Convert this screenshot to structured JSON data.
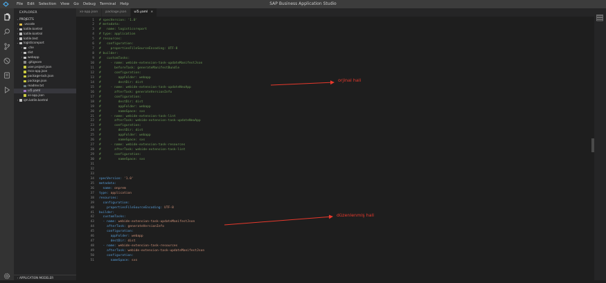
{
  "window": {
    "title": "SAP Business Application Studio",
    "menu": [
      "File",
      "Edit",
      "Selection",
      "View",
      "Go",
      "Debug",
      "Terminal",
      "Help"
    ]
  },
  "activity_bar": {
    "icons": [
      "files-icon",
      "search-icon",
      "source-control-icon",
      "debug-icon",
      "extensions-icon",
      "run-icon"
    ]
  },
  "sidebar": {
    "title": "EXPLORER",
    "section": "PROJECTS",
    "items": [
      {
        "label": ".vscode",
        "depth": 0,
        "type": "folder",
        "color": "#e6c34c"
      },
      {
        "label": "katile.kontrol",
        "depth": 0,
        "type": "folder",
        "color": "#c5c5c5"
      },
      {
        "label": "katile.kontrol",
        "depth": 0,
        "type": "folder",
        "color": "#c5c5c5"
      },
      {
        "label": "katile.test",
        "depth": 0,
        "type": "folder",
        "color": "#c5c5c5"
      },
      {
        "label": "logisticsreport",
        "depth": 0,
        "type": "folder-open",
        "color": "#c5c5c5"
      },
      {
        "label": ".che",
        "depth": 1,
        "type": "folder",
        "color": "#c5c5c5"
      },
      {
        "label": "dist",
        "depth": 1,
        "type": "folder",
        "color": "#c5c5c5"
      },
      {
        "label": "webapp",
        "depth": 1,
        "type": "folder",
        "color": "#c5c5c5"
      },
      {
        "label": ".gitignore",
        "depth": 1,
        "type": "file",
        "color": "#8a8a8a"
      },
      {
        "label": "user.project.json",
        "depth": 1,
        "type": "file",
        "color": "#cbcb41"
      },
      {
        "label": "mco-app.json",
        "depth": 1,
        "type": "file",
        "color": "#cbcb41"
      },
      {
        "label": "package-lock.json",
        "depth": 1,
        "type": "file",
        "color": "#cbcb41"
      },
      {
        "label": "package.json",
        "depth": 1,
        "type": "file",
        "color": "#cbcb41"
      },
      {
        "label": "readme.txt",
        "depth": 1,
        "type": "file",
        "color": "#6d8086"
      },
      {
        "label": "ui5.yaml",
        "depth": 1,
        "type": "file",
        "color": "#a074c4",
        "selected": true
      },
      {
        "label": "xs-app.json",
        "depth": 1,
        "type": "file",
        "color": "#cbcb41"
      },
      {
        "label": "qm.katile.kontrol",
        "depth": 0,
        "type": "folder",
        "color": "#c5c5c5"
      }
    ],
    "bottom_section": "APPLICATION MODELER"
  },
  "tabs": [
    {
      "label": "xs-app.json",
      "active": false
    },
    {
      "label": "package.json",
      "active": false
    },
    {
      "label": "ui5.yaml",
      "active": true,
      "close": "×"
    }
  ],
  "annotations": {
    "original": "orjinal hali",
    "edited": "düzenlenmiş hali",
    "color": "#e8392c"
  },
  "code": [
    {
      "n": "1",
      "t": "# specVersion: '1.0'",
      "c": "comment"
    },
    {
      "n": "2",
      "t": "# metadata:",
      "c": "comment"
    },
    {
      "n": "3",
      "t": "#   name: logisticsreport",
      "c": "comment"
    },
    {
      "n": "4",
      "t": "# type: application",
      "c": "comment"
    },
    {
      "n": "5",
      "t": "# resources:",
      "c": "comment"
    },
    {
      "n": "6",
      "t": "#   configuration:",
      "c": "comment"
    },
    {
      "n": "7",
      "t": "#     propertiesFileSourceEncoding: UTF-8",
      "c": "comment"
    },
    {
      "n": "8",
      "t": "# builder:",
      "c": "comment"
    },
    {
      "n": "9",
      "t": "#   customTasks:",
      "c": "comment"
    },
    {
      "n": "10",
      "t": "#     - name: webide-extension-task-updateManifestJson",
      "c": "comment"
    },
    {
      "n": "11",
      "t": "#       beforeTask: generateManifestBundle",
      "c": "comment"
    },
    {
      "n": "12",
      "t": "#       configuration:",
      "c": "comment"
    },
    {
      "n": "13",
      "t": "#         appFolder: webapp",
      "c": "comment"
    },
    {
      "n": "14",
      "t": "#         destDir: dist",
      "c": "comment"
    },
    {
      "n": "15",
      "t": "#     - name: webide-extension-task-updateNeoApp",
      "c": "comment"
    },
    {
      "n": "16",
      "t": "#       afterTask: generateVersionInfo",
      "c": "comment"
    },
    {
      "n": "17",
      "t": "#       configuration:",
      "c": "comment"
    },
    {
      "n": "18",
      "t": "#         destDir: dist",
      "c": "comment"
    },
    {
      "n": "19",
      "t": "#         appFolder: webapp",
      "c": "comment"
    },
    {
      "n": "20",
      "t": "#         nameSpace: sxs",
      "c": "comment"
    },
    {
      "n": "21",
      "t": "#     - name: webide-extension-task-lint",
      "c": "comment"
    },
    {
      "n": "22",
      "t": "#       afterTask: webide-extension-task-updateNeoApp",
      "c": "comment"
    },
    {
      "n": "23",
      "t": "#       configuration:",
      "c": "comment"
    },
    {
      "n": "24",
      "t": "#         destDir: dist",
      "c": "comment"
    },
    {
      "n": "25",
      "t": "#         appFolder: webapp",
      "c": "comment"
    },
    {
      "n": "26",
      "t": "#         nameSpace: sxs",
      "c": "comment"
    },
    {
      "n": "27",
      "t": "#     - name: webide-extension-task-resources",
      "c": "comment"
    },
    {
      "n": "28",
      "t": "#       afterTask: webide-extension-task-lint",
      "c": "comment"
    },
    {
      "n": "29",
      "t": "#       configuration:",
      "c": "comment"
    },
    {
      "n": "30",
      "t": "#         nameSpace: sxs",
      "c": "comment"
    },
    {
      "n": "31",
      "t": "",
      "c": "plain"
    },
    {
      "n": "32",
      "t": "",
      "c": "plain"
    },
    {
      "n": "33",
      "t": "",
      "c": "plain"
    },
    {
      "n": "34",
      "k": "specVersion:",
      "v": " '1.0'",
      "i": ""
    },
    {
      "n": "35",
      "k": "metadata:",
      "v": "",
      "i": ""
    },
    {
      "n": "36",
      "k": "name:",
      "v": " onprem",
      "i": "  "
    },
    {
      "n": "37",
      "k": "type:",
      "v": " application",
      "i": ""
    },
    {
      "n": "38",
      "k": "resources:",
      "v": "",
      "i": ""
    },
    {
      "n": "39",
      "k": "configuration:",
      "v": "",
      "i": "  "
    },
    {
      "n": "40",
      "k": "propertiesFileSourceEncoding:",
      "v": " UTF-8",
      "i": "    "
    },
    {
      "n": "41",
      "k": "builder:",
      "v": "",
      "i": ""
    },
    {
      "n": "42",
      "k": "customTasks:",
      "v": "",
      "i": "  "
    },
    {
      "n": "43",
      "k": "- name:",
      "v": " webide-extension-task-updateManifestJson",
      "i": "  "
    },
    {
      "n": "44",
      "k": "afterTask:",
      "v": " generateVersionInfo",
      "i": "    "
    },
    {
      "n": "45",
      "k": "configuration:",
      "v": "",
      "i": "    "
    },
    {
      "n": "46",
      "k": "appFolder:",
      "v": " webapp",
      "i": "      "
    },
    {
      "n": "47",
      "k": "destDir:",
      "v": " dist",
      "i": "      "
    },
    {
      "n": "48",
      "k": "- name:",
      "v": " webide-extension-task-resources",
      "i": "  "
    },
    {
      "n": "49",
      "k": "afterTask:",
      "v": " webide-extension-task-updateManifestJson",
      "i": "    "
    },
    {
      "n": "50",
      "k": "configuration:",
      "v": "",
      "i": "    "
    },
    {
      "n": "51",
      "k": "nameSpace:",
      "v": " sxs",
      "i": "      "
    }
  ]
}
